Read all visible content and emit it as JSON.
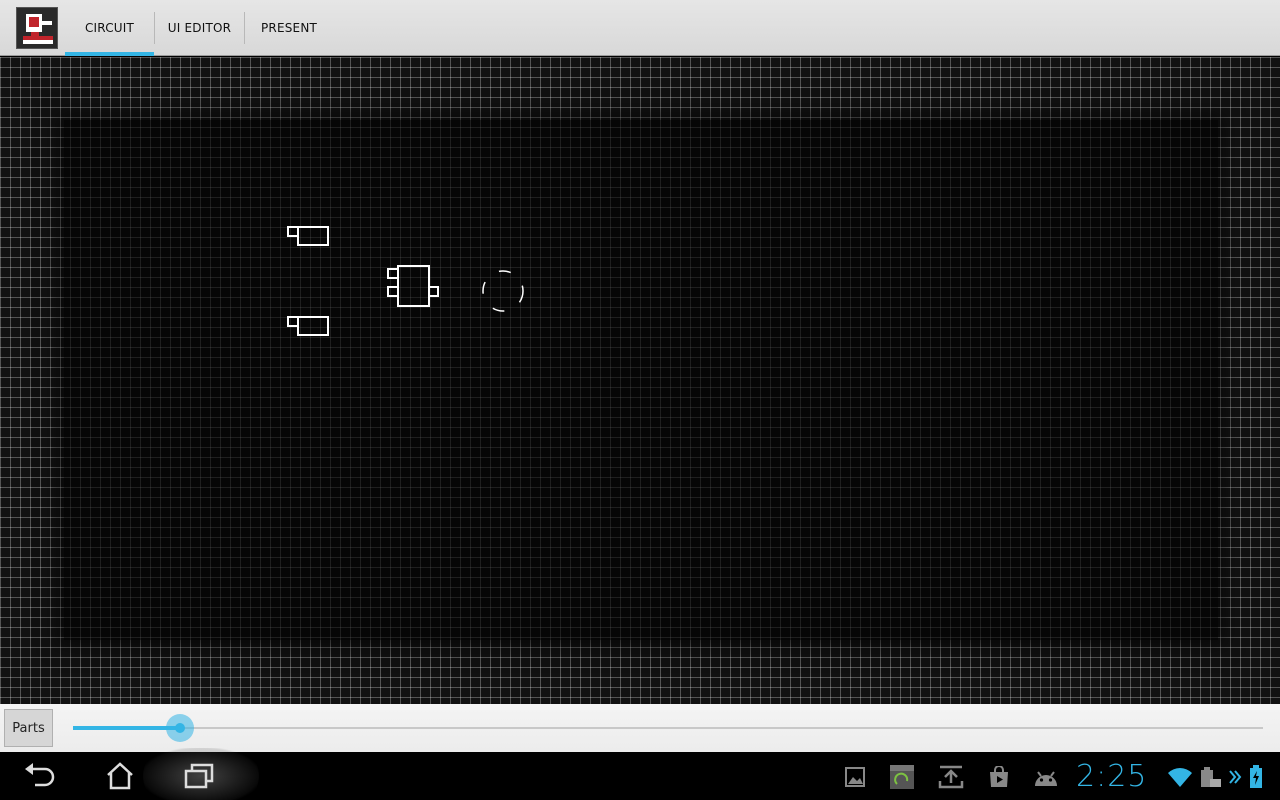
{
  "action_bar": {
    "app_icon": "circuit-app-icon",
    "tabs": [
      {
        "label": "CIRCUIT",
        "active": true
      },
      {
        "label": "UI EDITOR",
        "active": false
      },
      {
        "label": "PRESENT",
        "active": false
      }
    ]
  },
  "canvas": {
    "components": [
      {
        "type": "input-block"
      },
      {
        "type": "input-block"
      },
      {
        "type": "logic-gate"
      },
      {
        "type": "output-led"
      }
    ]
  },
  "toolbar": {
    "parts_label": "Parts",
    "zoom_level": 0.09
  },
  "system_bar": {
    "nav": [
      "back-icon",
      "home-icon",
      "recents-icon"
    ],
    "notifications": [
      "gallery-icon",
      "screenshot-icon",
      "upload-icon",
      "play-store-icon",
      "android-icon"
    ],
    "clock": "2:25",
    "status": [
      "wifi-icon",
      "keyboard-icon",
      "chevron-icon",
      "battery-icon"
    ],
    "accent_color": "#33b5e5"
  }
}
